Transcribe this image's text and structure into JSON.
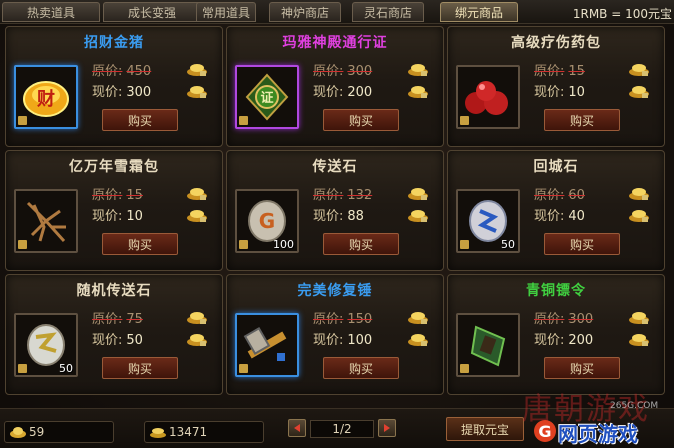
{
  "tabs": [
    {
      "label": "热卖道具"
    },
    {
      "label": "成长变强"
    },
    {
      "label": "常用道具"
    },
    {
      "label": "神炉商店"
    },
    {
      "label": "灵石商店"
    },
    {
      "label": "绑元商品"
    }
  ],
  "exchange_rate": "1RMB = 100元宝",
  "labels": {
    "orig_price": "原价:",
    "current_price": "现价:",
    "buy": "购买"
  },
  "items": [
    {
      "name": "招财金猪",
      "name_color": "#3a9cf0",
      "frame": "blue",
      "orig_price": "450",
      "price": "300",
      "icon": "gold-pig-icon",
      "qty": ""
    },
    {
      "name": "玛雅神殿通行证",
      "name_color": "#e040e0",
      "frame": "purple",
      "orig_price": "300",
      "price": "200",
      "icon": "maya-pass-icon",
      "qty": ""
    },
    {
      "name": "高级疗伤药包",
      "name_color": "#e8dcc0",
      "frame": "plain",
      "orig_price": "15",
      "price": "10",
      "icon": "potion-pack-icon",
      "qty": ""
    },
    {
      "name": "亿万年雪霜包",
      "name_color": "#e8dcc0",
      "frame": "plain",
      "orig_price": "15",
      "price": "10",
      "icon": "root-herb-icon",
      "qty": ""
    },
    {
      "name": "传送石",
      "name_color": "#e8dcc0",
      "frame": "plain",
      "orig_price": "132",
      "price": "88",
      "icon": "teleport-stone-icon",
      "qty": "100"
    },
    {
      "name": "回城石",
      "name_color": "#e8dcc0",
      "frame": "plain",
      "orig_price": "60",
      "price": "40",
      "icon": "return-stone-icon",
      "qty": "50"
    },
    {
      "name": "随机传送石",
      "name_color": "#e8dcc0",
      "frame": "plain",
      "orig_price": "75",
      "price": "50",
      "icon": "random-stone-icon",
      "qty": "50"
    },
    {
      "name": "完美修复锤",
      "name_color": "#3a9cf0",
      "frame": "blue",
      "orig_price": "150",
      "price": "100",
      "icon": "repair-hammer-icon",
      "qty": ""
    },
    {
      "name": "青铜镖令",
      "name_color": "#40d040",
      "frame": "plain",
      "orig_price": "300",
      "price": "200",
      "icon": "bronze-token-icon",
      "qty": ""
    }
  ],
  "footer": {
    "bound_yuanbao": "59",
    "yuanbao": "13471",
    "page": "1/2",
    "withdraw_label": "提取元宝"
  },
  "watermark": {
    "line1": "唐朝游戏",
    "line2": "265G.COM",
    "logo_letter": "G",
    "line3": "网页游戏"
  }
}
